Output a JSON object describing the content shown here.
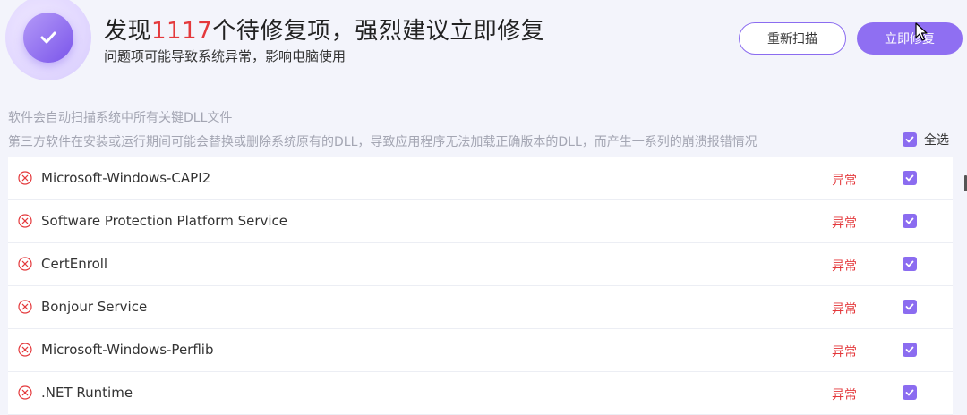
{
  "header": {
    "title_prefix": "发现",
    "issue_count": "1117",
    "title_suffix": "个待修复项，强烈建议立即修复",
    "subtitle": "问题项可能导致系统异常，影响电脑使用"
  },
  "buttons": {
    "rescan": "重新扫描",
    "fix_now": "立即修复"
  },
  "description": {
    "line1": "软件会自动扫描系统中所有关键DLL文件",
    "line2": "第三方软件在安装或运行期间可能会替换或删除系统原有的DLL，导致应用程序无法加载正确版本的DLL，而产生一系列的崩溃报错情况"
  },
  "select_all": {
    "label": "全选",
    "checked": true
  },
  "items": [
    {
      "name": "Microsoft-Windows-CAPI2",
      "status": "异常",
      "checked": true
    },
    {
      "name": "Software Protection Platform Service",
      "status": "异常",
      "checked": true
    },
    {
      "name": "CertEnroll",
      "status": "异常",
      "checked": true
    },
    {
      "name": "Bonjour Service",
      "status": "异常",
      "checked": true
    },
    {
      "name": "Microsoft-Windows-Perflib",
      "status": "异常",
      "checked": true
    },
    {
      "name": ".NET Runtime",
      "status": "异常",
      "checked": true
    }
  ],
  "colors": {
    "accent": "#8b6cf0",
    "error": "#e4393c",
    "background": "#f3f4fb"
  },
  "icons": {
    "logo": "check-shield-icon",
    "item_status": "error-circle-x-icon",
    "checkbox": "checkbox-checked-icon"
  }
}
